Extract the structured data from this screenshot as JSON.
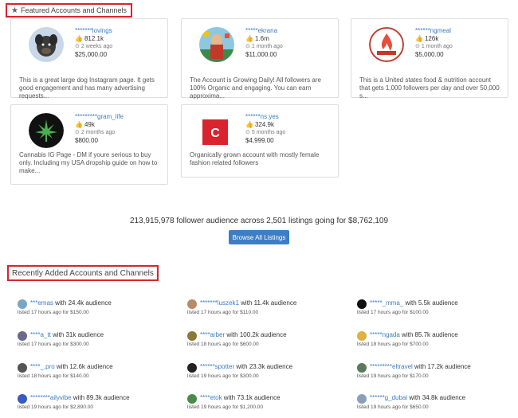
{
  "featured": {
    "title": "Featured Accounts and Channels",
    "cards": [
      {
        "handle": "*******lovings",
        "followers": "812.1k",
        "age": "2 weeks ago",
        "price": "$25,000.00",
        "desc": "This is a great large dog Instagram page. It gets good engagement and has many advertising requests..."
      },
      {
        "handle": "*****ekrana",
        "followers": "1.6m",
        "age": "1 month ago",
        "price": "$11,000.00",
        "desc": "The Account is Growing Daily! All followers are 100% Organic and engaging. You can earn approxima..."
      },
      {
        "handle": "******ngmeal",
        "followers": "126k",
        "age": "1 month ago",
        "price": "$5,000.00",
        "desc": "This is a United states food & nutrition account that gets 1,000 followers per day and over 50,000 s..."
      },
      {
        "handle": "*********gram_life",
        "followers": "49k",
        "age": "2 months ago",
        "price": "$800.00",
        "desc": "Cannabis IG Page - DM if youre serious to buy only. Including my USA dropship guide on how to make..."
      },
      {
        "handle": "******ns.yes",
        "followers": "324.9k",
        "age": "5 months ago",
        "price": "$4,999.00",
        "desc": "Organically grown account with mostly female fashion related followers"
      }
    ]
  },
  "summary": {
    "text": "213,915,978 follower audience across 2,501 listings going for $8,762,109",
    "browse_label": "Browse All Listings"
  },
  "recent": {
    "title": "Recently Added Accounts and Channels",
    "items": [
      {
        "name": "***emas",
        "rest": " with 24.4k audience",
        "sub": "listed 17 hours ago for $150.00"
      },
      {
        "name": "*******luszek1",
        "rest": " with 11.4k audience",
        "sub": "listed 17 hours ago for $110.00"
      },
      {
        "name": "*****_mma_",
        "rest": " with 5.5k audience",
        "sub": "listed 17 hours ago for $100.00"
      },
      {
        "name": "****a_tt",
        "rest": " with 31k audience",
        "sub": "listed 17 hours ago for $300.00"
      },
      {
        "name": "****arber",
        "rest": " with 100.2k audience",
        "sub": "listed 18 hours ago for $600.00"
      },
      {
        "name": "*****ngada",
        "rest": " with 85.7k audience",
        "sub": "listed 18 hours ago for $700.00"
      },
      {
        "name": "****_.pro",
        "rest": " with 12.6k audience",
        "sub": "listed 18 hours ago for $140.00"
      },
      {
        "name": "******spotter",
        "rest": " with 23.3k audience",
        "sub": "listed 19 hours ago for $300.00"
      },
      {
        "name": "*********eltravel",
        "rest": " with 17.2k audience",
        "sub": "listed 19 hours ago for $170.00"
      },
      {
        "name": "********ailyvibe",
        "rest": " with 89.3k audience",
        "sub": "listed 19 hours ago for $2,890.00"
      },
      {
        "name": "****etok",
        "rest": " with 73.1k audience",
        "sub": "listed 19 hours ago for $1,200.00"
      },
      {
        "name": "******g_dubai",
        "rest": " with 34.8k audience",
        "sub": "listed 19 hours ago for $650.00"
      }
    ]
  },
  "colors": {
    "accent": "#3d7ec3",
    "highlight_border": "#d9232e"
  }
}
